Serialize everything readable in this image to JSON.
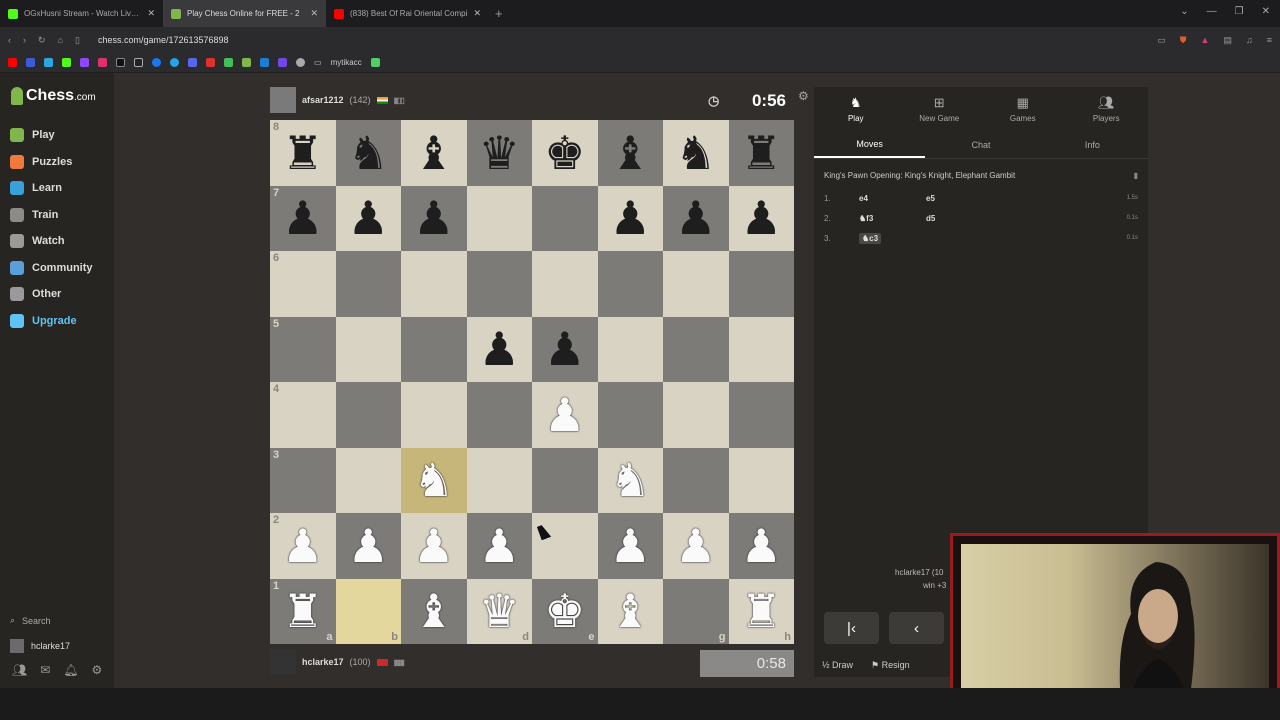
{
  "browser": {
    "tabs": [
      {
        "title": "OGxHusni Stream - Watch Live o",
        "color": "#53fc18",
        "active": false
      },
      {
        "title": "Play Chess Online for FREE - 2",
        "color": "#81b64c",
        "active": true
      },
      {
        "title": "(838) Best Of Rai Oriental Compi",
        "color": "#ff0000",
        "active": false
      }
    ],
    "url": "chess.com/game/172613576898",
    "bookmark_folder": "mytikacc"
  },
  "sidebar": {
    "logo": "Chess",
    "logo_suffix": ".com",
    "items": [
      {
        "label": "Play",
        "color": "#81b64c"
      },
      {
        "label": "Puzzles",
        "color": "#f07a3c"
      },
      {
        "label": "Learn",
        "color": "#3aa0d8"
      },
      {
        "label": "Train",
        "color": "#8d8b88"
      },
      {
        "label": "Watch",
        "color": "#9a9a9a"
      },
      {
        "label": "Community",
        "color": "#5a9fd8"
      },
      {
        "label": "Other",
        "color": "#9a9a9a"
      },
      {
        "label": "Upgrade",
        "color": "#5fc4f5"
      }
    ],
    "search_label": "Search",
    "username": "hclarke17"
  },
  "game": {
    "top_player": {
      "name": "afsar1212",
      "rating": "(142)"
    },
    "bottom_player": {
      "name": "hclarke17",
      "rating": "(100)"
    },
    "top_clock": "0:56",
    "bottom_clock": "0:58",
    "board": [
      [
        "br",
        "bn",
        "bb",
        "bq",
        "bk",
        "bb",
        "bn",
        "br"
      ],
      [
        "bp",
        "bp",
        "bp",
        "",
        "",
        "bp",
        "bp",
        "bp"
      ],
      [
        "",
        "",
        "",
        "",
        "",
        "",
        "",
        ""
      ],
      [
        "",
        "",
        "",
        "bp",
        "bp",
        "",
        "",
        ""
      ],
      [
        "",
        "",
        "",
        "",
        "wp",
        "",
        "",
        ""
      ],
      [
        "",
        "",
        "wn",
        "",
        "",
        "wn",
        "",
        ""
      ],
      [
        "wp",
        "wp",
        "wp",
        "wp",
        "",
        "wp",
        "wp",
        "wp"
      ],
      [
        "wr",
        "",
        "wb",
        "wq",
        "wk",
        "wb",
        "",
        "wr"
      ]
    ],
    "ranks": [
      "8",
      "7",
      "6",
      "5",
      "4",
      "3",
      "2",
      "1"
    ],
    "files": [
      "a",
      "b",
      "c",
      "d",
      "e",
      "f",
      "g",
      "h"
    ],
    "visible_files": [
      "a",
      "b",
      "",
      "d",
      "e",
      "",
      "g",
      "h"
    ],
    "highlight": [
      "b1",
      "c3"
    ]
  },
  "panel": {
    "tabs": [
      "Play",
      "New Game",
      "Games",
      "Players"
    ],
    "subtabs": [
      "Moves",
      "Chat",
      "Info"
    ],
    "opening": "King's Pawn Opening: King's Knight, Elephant Gambit",
    "moves": [
      {
        "n": "1.",
        "w": "e4",
        "b": "e5",
        "t": "1.5s"
      },
      {
        "n": "2.",
        "w": "♞f3",
        "b": "d5",
        "t": "0.1s"
      },
      {
        "n": "3.",
        "w": "♞c3",
        "b": "",
        "t": "0.1s"
      }
    ],
    "draw_label": "Draw",
    "draw_prefix": "½",
    "resign_label": "Resign",
    "overlay_user": "hclarke17 (10",
    "overlay_win": "win +3"
  }
}
